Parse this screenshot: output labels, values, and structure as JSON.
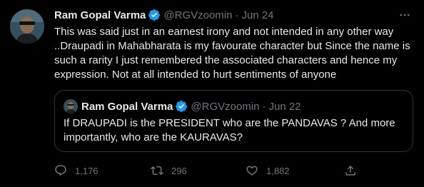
{
  "tweet": {
    "author_name": "Ram Gopal Varma",
    "handle": "@RGVzoomin",
    "separator": "·",
    "date": "Jun 24",
    "body_lines": [
      "This was said just in an earnest irony and not intended in any other way",
      "..Draupadi in Mahabharata is my favourate character but Since the name is",
      "such a rarity I just remembered the associated characters and hence my",
      "expression. Not at all intended to hurt sentiments of anyone"
    ]
  },
  "quoted_tweet": {
    "author_name": "Ram Gopal Varma",
    "handle": "@RGVzoomin",
    "separator": "·",
    "date": "Jun 22",
    "body_lines": [
      "If DRAUPADI is the PRESIDENT who are the PANDAVAS ? And more",
      "importantly, who are the KAURAVAS?"
    ]
  },
  "actions": {
    "reply_count": "1,176",
    "retweet_count": "296",
    "like_count": "1,882"
  },
  "icons": {
    "verified": "verified-badge-icon",
    "more": "more-options-icon",
    "reply": "reply-icon",
    "retweet": "retweet-icon",
    "like": "like-icon",
    "share": "share-icon"
  },
  "colors": {
    "background": "#000000",
    "text": "#e7e9ea",
    "secondary_text": "#71767b",
    "verified": "#1d9bf0",
    "border": "#2f3336"
  }
}
